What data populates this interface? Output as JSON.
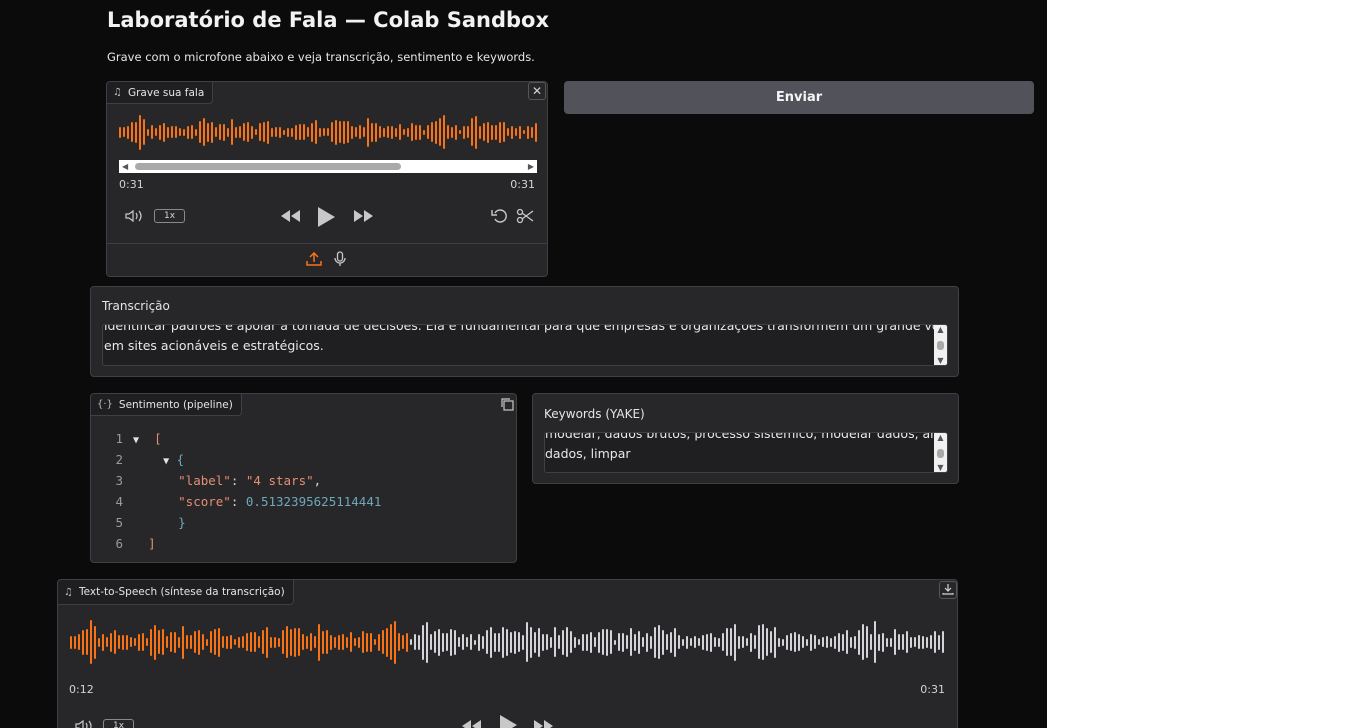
{
  "header": {
    "title": "Laboratório de Fala — Colab Sandbox",
    "subtitle": "Grave com o microfone abaixo e veja transcrição, sentimento e keywords."
  },
  "recorder": {
    "label": "Grave sua fala",
    "time_current": "0:31",
    "time_total": "0:31",
    "speed": "1x",
    "progress": 1.0,
    "wave_color": "#f97316"
  },
  "send_button": {
    "label": "Enviar"
  },
  "transcription": {
    "label": "Transcrição",
    "line1": "identificar padrões e apoiar a tomada de decisões. Ela é fundamental para que empresas e organizações transformem um grande volume de informações",
    "line2": "em sites acionáveis e estratégicos."
  },
  "sentiment": {
    "label": "Sentimento (pipeline)",
    "line_numbers": [
      "1",
      "2",
      "3",
      "4",
      "5",
      "6"
    ],
    "label_key": "\"label\"",
    "label_value": "\"4 stars\"",
    "score_key": "\"score\"",
    "score_value": "0.5132395625114441"
  },
  "keywords": {
    "label": "Keywords (YAKE)",
    "line1": "modelar, dados brutos, processo sistemico, modelar dados, análise de",
    "line2": "dados, limpar"
  },
  "tts": {
    "label": "Text-to-Speech (síntese da transcrição)",
    "time_current": "0:12",
    "time_total": "0:31",
    "speed": "1x",
    "progress": 0.387,
    "played_color": "#f97316",
    "unplayed_color": "#d4d4d8"
  },
  "icons": [
    "music-note-icon",
    "close-icon",
    "volume-icon",
    "rewind-icon",
    "play-icon",
    "fast-forward-icon",
    "undo-icon",
    "scissors-icon",
    "upload-icon",
    "microphone-icon",
    "code-icon",
    "copy-icon",
    "download-icon"
  ]
}
